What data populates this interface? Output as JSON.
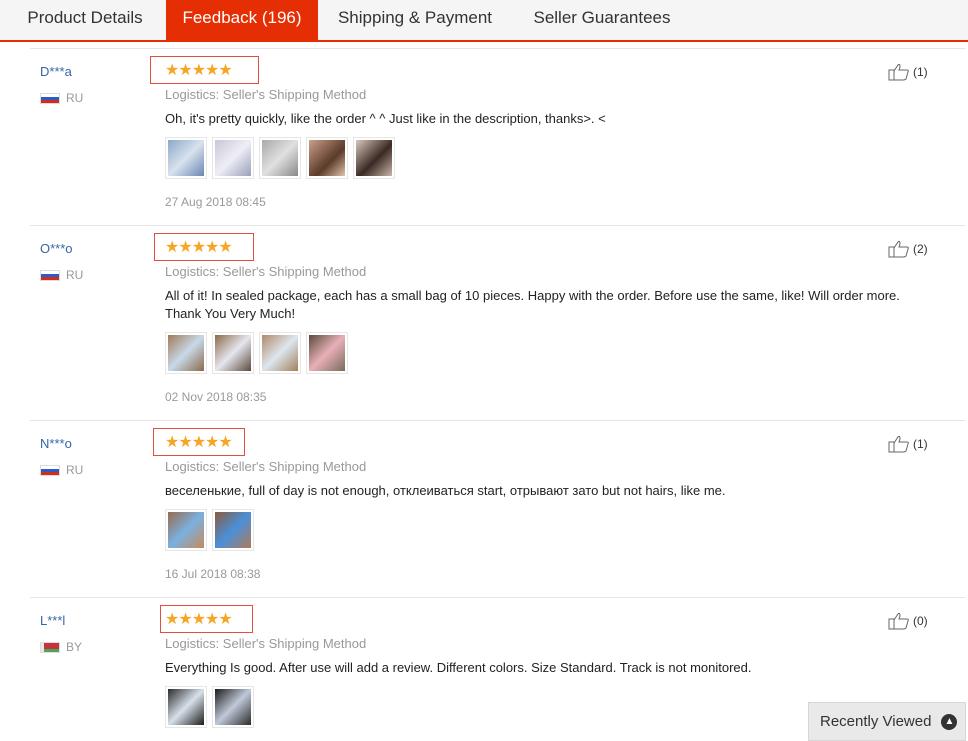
{
  "tabs": [
    {
      "label": "Product Details",
      "active": false
    },
    {
      "label": "Feedback (196)",
      "active": true
    },
    {
      "label": "Shipping & Payment",
      "active": false
    },
    {
      "label": "Seller Guarantees",
      "active": false
    }
  ],
  "reviews": [
    {
      "user": "D***a",
      "country": "RU",
      "rating": 5,
      "logistics": "Logistics: Seller's Shipping Method",
      "content": "Oh, it's pretty quickly, like the order ^ ^ Just like in the description, thanks>. <",
      "photos": 5,
      "date": "27 Aug 2018 08:45",
      "helpful": "(1)"
    },
    {
      "user": "O***o",
      "country": "RU",
      "rating": 5,
      "logistics": "Logistics: Seller's Shipping Method",
      "content": "All of it! In sealed package, each has a small bag of 10 pieces. Happy with the order. Before use the same, like! Will order more. Thank You Very Much!",
      "photos": 4,
      "date": "02 Nov 2018 08:35",
      "helpful": "(2)"
    },
    {
      "user": "N***o",
      "country": "RU",
      "rating": 5,
      "logistics": "Logistics: Seller's Shipping Method",
      "content": "веселенькие, full of day is not enough, отклеиваться start, отрывают зато but not hairs, like me.",
      "photos": 2,
      "date": "16 Jul 2018 08:38",
      "helpful": "(1)"
    },
    {
      "user": "L***l",
      "country": "BY",
      "rating": 5,
      "logistics": "Logistics: Seller's Shipping Method",
      "content": "Everything Is good. After use will add a review. Different colors. Size Standard. Track is not monitored.",
      "photos": 2,
      "date": "",
      "helpful": "(0)"
    }
  ],
  "stars": "★★★★★",
  "recently_viewed": {
    "label": "Recently Viewed",
    "icon": "chevron-up-icon"
  },
  "colors": {
    "accent": "#e62e04",
    "star": "#f6a623",
    "username": "#3366aa"
  }
}
